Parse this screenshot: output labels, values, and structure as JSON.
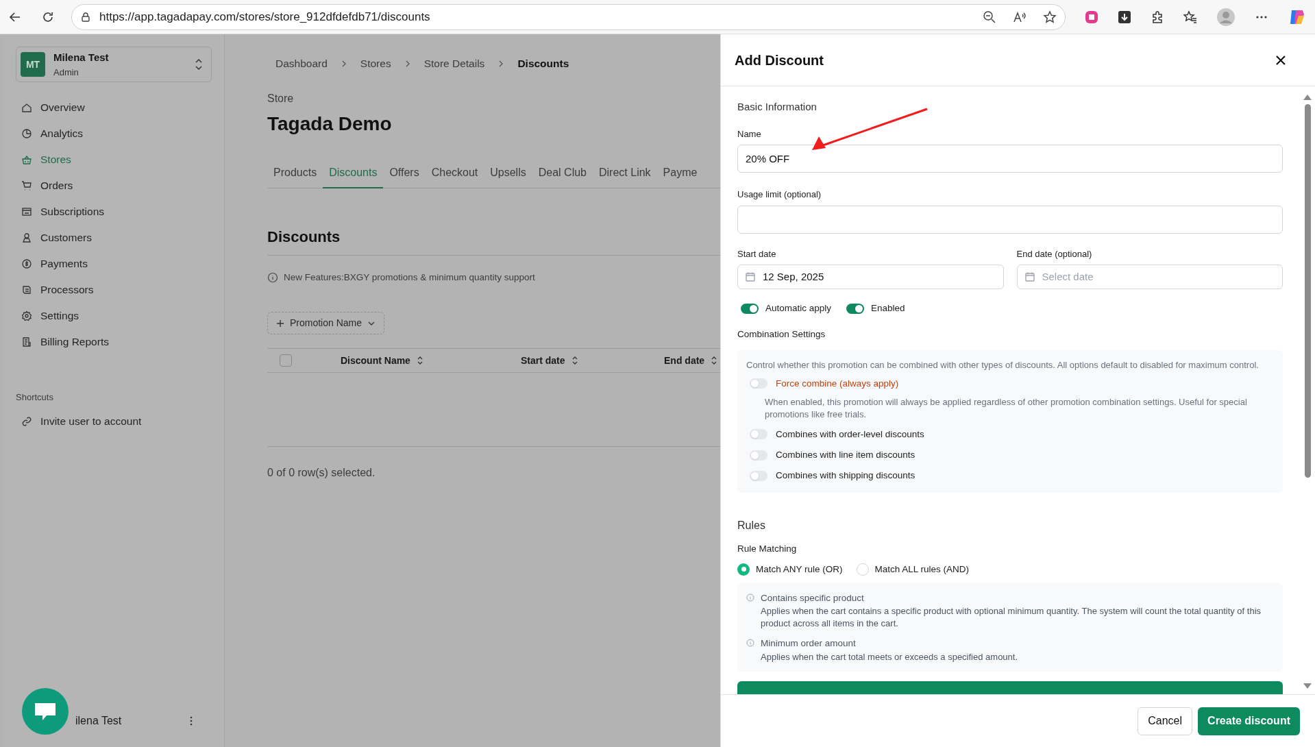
{
  "browser": {
    "url": "https://app.tagadapay.com/stores/store_912dfdefdb71/discounts"
  },
  "sidebar": {
    "account": {
      "initials": "MT",
      "name": "Milena Test",
      "role": "Admin"
    },
    "nav": [
      {
        "label": "Overview",
        "selected": false
      },
      {
        "label": "Analytics",
        "selected": false
      },
      {
        "label": "Stores",
        "selected": true
      },
      {
        "label": "Orders",
        "selected": false
      },
      {
        "label": "Subscriptions",
        "selected": false
      },
      {
        "label": "Customers",
        "selected": false
      },
      {
        "label": "Payments",
        "selected": false
      },
      {
        "label": "Processors",
        "selected": false
      },
      {
        "label": "Settings",
        "selected": false
      },
      {
        "label": "Billing Reports",
        "selected": false
      }
    ],
    "shortcuts_title": "Shortcuts",
    "shortcuts": [
      {
        "label": "Invite user to account"
      }
    ],
    "footer_user": "ilena Test"
  },
  "main": {
    "breadcrumb": [
      {
        "label": "Dashboard",
        "current": false
      },
      {
        "label": "Stores",
        "current": false
      },
      {
        "label": "Store Details",
        "current": false
      },
      {
        "label": "Discounts",
        "current": true
      }
    ],
    "store_label": "Store",
    "store_name": "Tagada Demo",
    "tabs": [
      {
        "label": "Products",
        "selected": false
      },
      {
        "label": "Discounts",
        "selected": true
      },
      {
        "label": "Offers",
        "selected": false
      },
      {
        "label": "Checkout",
        "selected": false
      },
      {
        "label": "Upsells",
        "selected": false
      },
      {
        "label": "Deal Club",
        "selected": false
      },
      {
        "label": "Direct Link",
        "selected": false
      },
      {
        "label": "Payme",
        "selected": false
      }
    ],
    "section_title": "Discounts",
    "notice": "New Features:BXGY promotions & minimum quantity support",
    "filter_button": "Promotion Name",
    "table": {
      "select_all_checked": false,
      "columns": [
        "Discount Name",
        "Start date",
        "End date"
      ]
    },
    "selection_text": "0 of 0 row(s) selected."
  },
  "drawer": {
    "title": "Add Discount",
    "section": "Basic Information",
    "name_label": "Name",
    "name_value": "20% OFF",
    "usage_label": "Usage limit (optional)",
    "start_label": "Start date",
    "start_value": "12 Sep, 2025",
    "end_label": "End date (optional)",
    "end_placeholder": "Select date",
    "toggles": [
      {
        "label": "Automatic apply",
        "on": true
      },
      {
        "label": "Enabled",
        "on": true
      }
    ],
    "combination": {
      "title": "Combination Settings",
      "description": "Control whether this promotion can be combined with other types of discounts. All options default to disabled for maximum control.",
      "options": [
        {
          "kind": "warning",
          "label": "Force combine (always apply)",
          "on": false,
          "description": "When enabled, this promotion will always be applied regardless of other promotion combination settings. Useful for special promotions like free trials."
        },
        {
          "kind": "normal",
          "label": "Combines with order-level discounts",
          "on": false
        },
        {
          "kind": "normal",
          "label": "Combines with line item discounts",
          "on": false
        },
        {
          "kind": "normal",
          "label": "Combines with shipping discounts",
          "on": false
        }
      ]
    },
    "rules": {
      "title": "Rules",
      "matching_label": "Rule Matching",
      "radios": [
        {
          "label": "Match ANY rule (OR)",
          "selected": true
        },
        {
          "label": "Match ALL rules (AND)",
          "selected": false
        }
      ],
      "rule_types": [
        {
          "title": "Contains specific product",
          "description": "Applies when the cart contains a specific product with optional minimum quantity. The system will count the total quantity of this product across all items in the cart."
        },
        {
          "title": "Minimum order amount",
          "description": "Applies when the cart total meets or exceeds a specified amount."
        }
      ]
    },
    "buttons": {
      "cancel": "Cancel",
      "create": "Create discount"
    }
  }
}
